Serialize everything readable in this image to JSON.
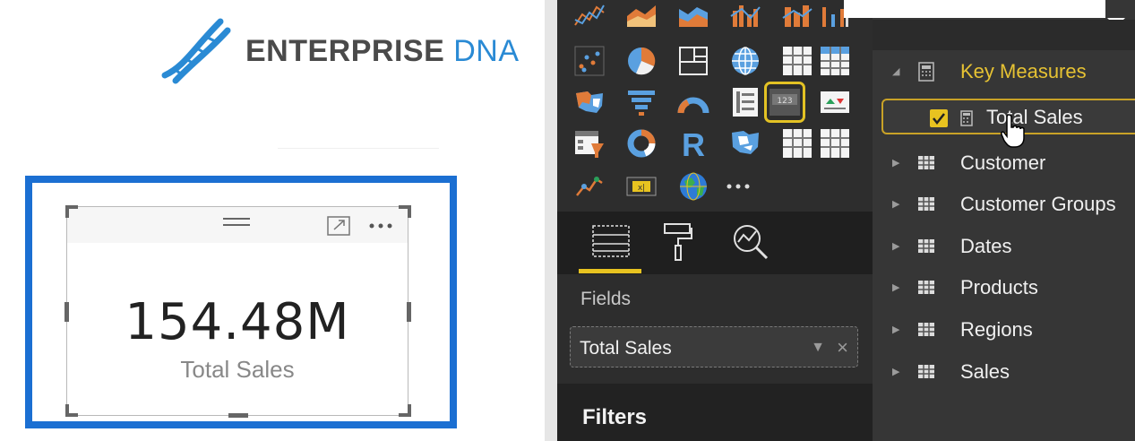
{
  "logo": {
    "word1": "ENTERPRISE",
    "word2": "DNA"
  },
  "card": {
    "value": "154.48M",
    "label": "Total Sales"
  },
  "visualizations": {
    "fields_section_label": "Fields",
    "value_well": "Total Sales",
    "filters_label": "Filters"
  },
  "fields_pane": {
    "key_measures": "Key Measures",
    "selected_measure": "Total Sales",
    "tables": [
      "Customer",
      "Customer Groups",
      "Dates",
      "Products",
      "Regions",
      "Sales"
    ]
  },
  "colors": {
    "selection_blue": "#1b6fd2",
    "accent_yellow": "#e8c320",
    "pane_dark": "#2d2d2d"
  }
}
